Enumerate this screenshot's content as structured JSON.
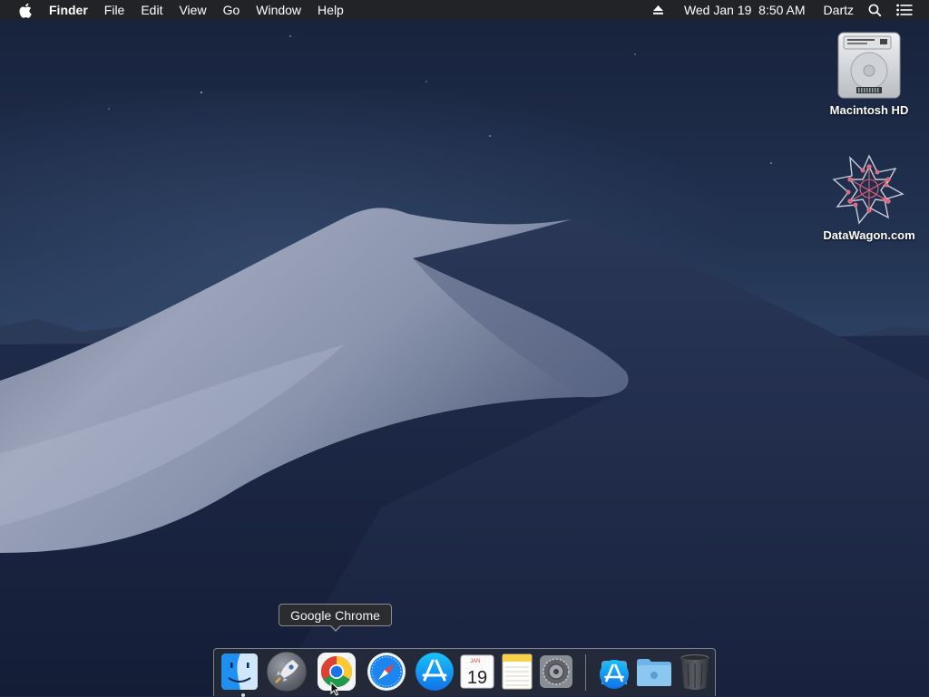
{
  "menubar": {
    "apple_icon": "apple-logo-icon",
    "app_name": "Finder",
    "menus": [
      "File",
      "Edit",
      "View",
      "Go",
      "Window",
      "Help"
    ],
    "status": {
      "eject_icon": "eject-icon",
      "datetime": "Wed Jan 19  8:50 AM",
      "user": "Dartz",
      "search_icon": "spotlight-search-icon",
      "list_icon": "notification-center-icon"
    }
  },
  "desktop": {
    "icons": [
      {
        "label": "Macintosh HD",
        "icon": "hard-drive-icon"
      },
      {
        "label": "DataWagon.com",
        "icon": "network-volume-icon"
      }
    ]
  },
  "tooltip": {
    "text": "Google Chrome"
  },
  "dock": {
    "apps": [
      {
        "name": "Finder",
        "icon": "finder-icon",
        "running": true
      },
      {
        "name": "Launchpad",
        "icon": "launchpad-icon",
        "running": false
      },
      {
        "name": "Google Chrome",
        "icon": "chrome-icon",
        "running": false
      },
      {
        "name": "Safari",
        "icon": "safari-icon",
        "running": false
      },
      {
        "name": "App Store",
        "icon": "app-store-icon",
        "running": false
      },
      {
        "name": "Calendar",
        "icon": "calendar-icon",
        "running": false,
        "month": "JAN",
        "day": "19"
      },
      {
        "name": "Notes",
        "icon": "notes-icon",
        "running": false
      },
      {
        "name": "System Preferences",
        "icon": "system-preferences-icon",
        "running": false
      },
      {
        "name": "Downloads",
        "icon": "downloads-stack-icon",
        "running": false
      },
      {
        "name": "Folder",
        "icon": "folder-icon",
        "running": false
      },
      {
        "name": "Trash",
        "icon": "trash-icon",
        "running": false
      }
    ]
  },
  "colors": {
    "menubar_bg": "#222326",
    "sky_top": "#1e2a44",
    "sky_bottom": "#2c3e5e",
    "dune_light": "#a7b0c4",
    "dune_dark": "#1c2848"
  }
}
